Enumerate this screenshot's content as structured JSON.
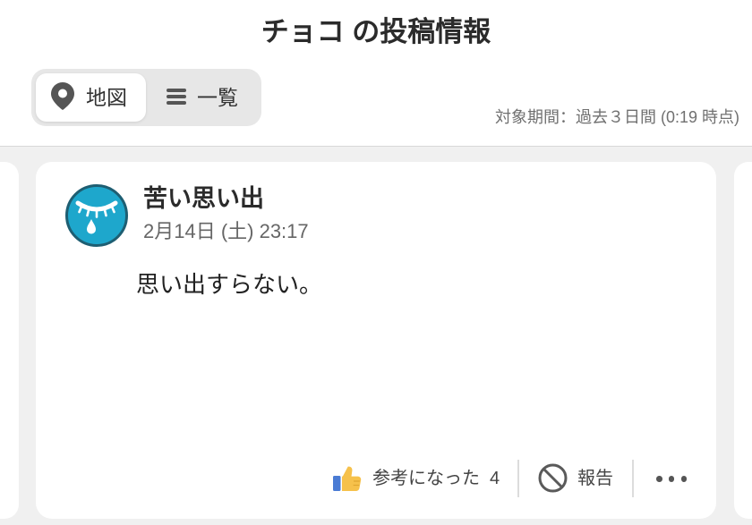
{
  "header": {
    "title": "チョコ の投稿情報",
    "tabs": [
      {
        "label": "地図",
        "icon": "map-pin-icon",
        "selected": true
      },
      {
        "label": "一覧",
        "icon": "list-icon",
        "selected": false
      }
    ],
    "period_text": "対象期間：過去３日間 (0:19 時点)"
  },
  "post": {
    "avatar_icon": "crying-eye-icon",
    "title": "苦い思い出",
    "date": "2月14日 (土) 23:17",
    "body": "思い出すらない。",
    "actions": {
      "helpful": {
        "icon": "thumbs-up-icon",
        "label": "参考になった",
        "count": "4"
      },
      "report": {
        "icon": "prohibit-icon",
        "label": "報告"
      },
      "more": {
        "icon": "more-icon"
      }
    }
  },
  "colors": {
    "background": "#f0f0f0",
    "card": "#ffffff",
    "text_primary": "#2b2b2b",
    "text_secondary": "#707070",
    "segment_bg": "#e7e7e7",
    "avatar_fill": "#1ea7cc",
    "avatar_ring": "#1e5e72",
    "thumb_yellow": "#f6c14b",
    "thumb_blue": "#4a7bd4"
  }
}
